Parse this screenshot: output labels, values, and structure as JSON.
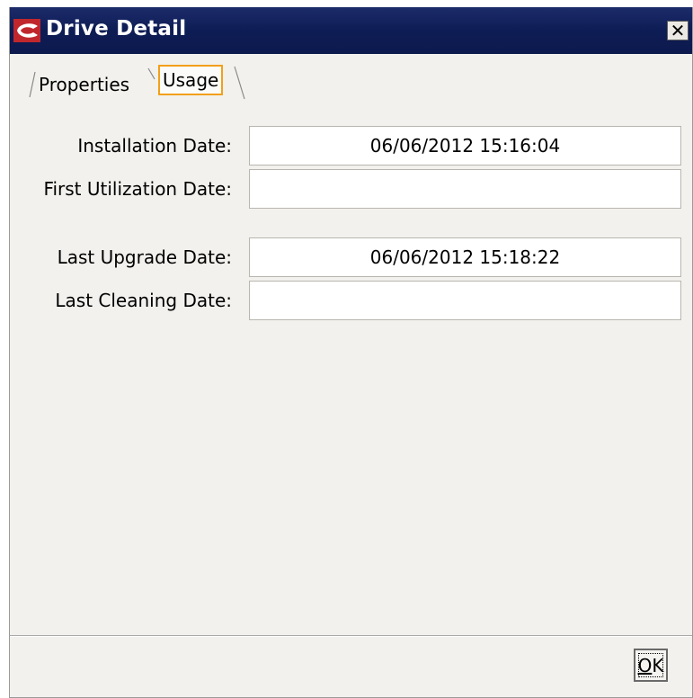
{
  "window": {
    "title": "Drive Detail",
    "close_icon": "close-icon",
    "app_icon": "app-logo-icon",
    "title_color": "#0e1c55",
    "accent_color": "#f2a01a"
  },
  "tabs": [
    {
      "label": "Properties",
      "selected": false
    },
    {
      "label": "Usage",
      "selected": true
    }
  ],
  "fields": [
    {
      "label": "Installation Date:",
      "value": "06/06/2012 15:16:04"
    },
    {
      "label": "First Utilization Date:",
      "value": ""
    },
    {
      "label": "Last Upgrade Date:",
      "value": "06/06/2012 15:18:22"
    },
    {
      "label": "Last Cleaning Date:",
      "value": ""
    }
  ],
  "footer": {
    "ok_label_mnemonic": "O",
    "ok_label_rest": "K"
  }
}
